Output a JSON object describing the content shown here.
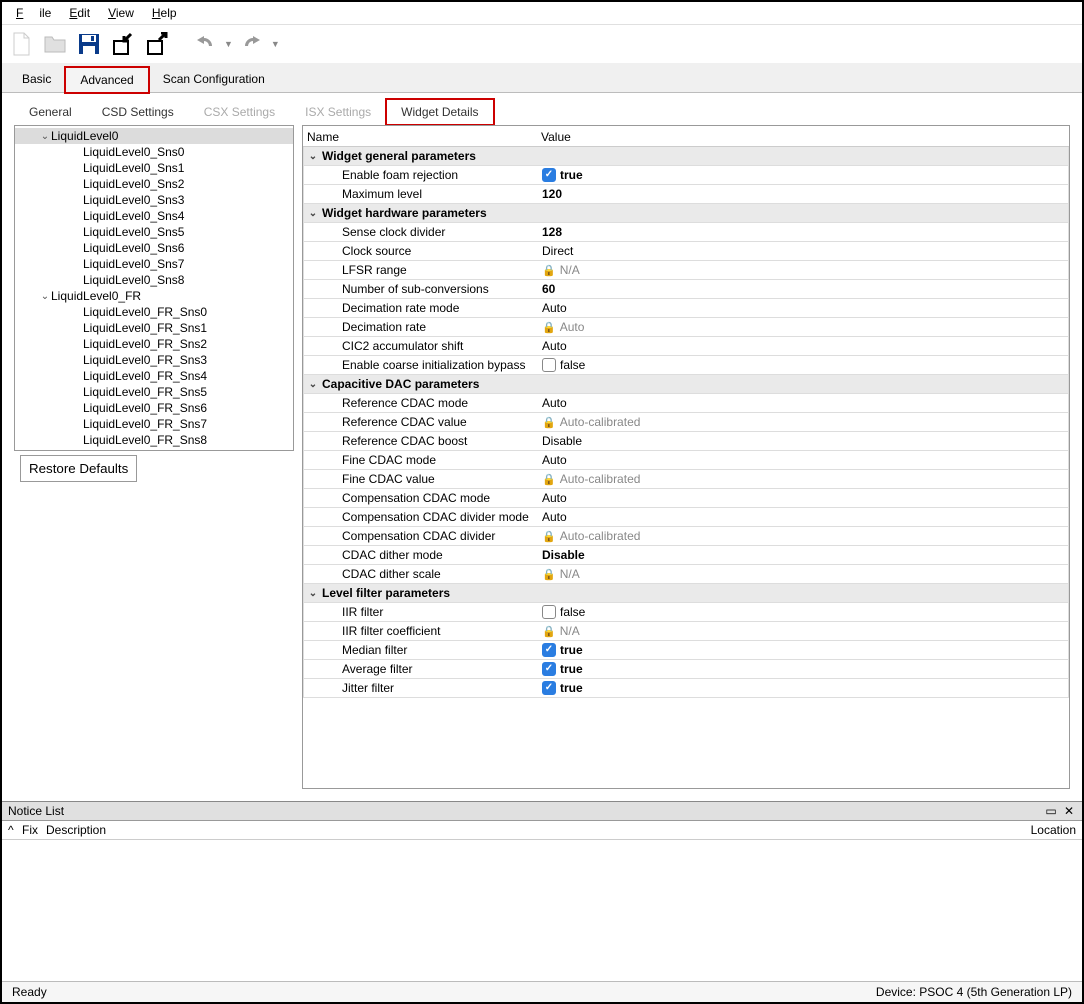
{
  "menu": {
    "file": "File",
    "edit": "Edit",
    "view": "View",
    "help": "Help"
  },
  "main_tabs": {
    "basic": "Basic",
    "advanced": "Advanced",
    "scan": "Scan Configuration",
    "active": "Advanced"
  },
  "sub_tabs": {
    "general": "General",
    "csd": "CSD Settings",
    "csx": "CSX Settings",
    "isx": "ISX Settings",
    "widget": "Widget Details",
    "active": "Widget Details"
  },
  "tree": [
    {
      "label": "LiquidLevel0",
      "depth": 1,
      "expand": true,
      "selected": true
    },
    {
      "label": "LiquidLevel0_Sns0",
      "depth": 2
    },
    {
      "label": "LiquidLevel0_Sns1",
      "depth": 2
    },
    {
      "label": "LiquidLevel0_Sns2",
      "depth": 2
    },
    {
      "label": "LiquidLevel0_Sns3",
      "depth": 2
    },
    {
      "label": "LiquidLevel0_Sns4",
      "depth": 2
    },
    {
      "label": "LiquidLevel0_Sns5",
      "depth": 2
    },
    {
      "label": "LiquidLevel0_Sns6",
      "depth": 2
    },
    {
      "label": "LiquidLevel0_Sns7",
      "depth": 2
    },
    {
      "label": "LiquidLevel0_Sns8",
      "depth": 2
    },
    {
      "label": "LiquidLevel0_FR",
      "depth": 1,
      "expand": true
    },
    {
      "label": "LiquidLevel0_FR_Sns0",
      "depth": 2
    },
    {
      "label": "LiquidLevel0_FR_Sns1",
      "depth": 2
    },
    {
      "label": "LiquidLevel0_FR_Sns2",
      "depth": 2
    },
    {
      "label": "LiquidLevel0_FR_Sns3",
      "depth": 2
    },
    {
      "label": "LiquidLevel0_FR_Sns4",
      "depth": 2
    },
    {
      "label": "LiquidLevel0_FR_Sns5",
      "depth": 2
    },
    {
      "label": "LiquidLevel0_FR_Sns6",
      "depth": 2
    },
    {
      "label": "LiquidLevel0_FR_Sns7",
      "depth": 2
    },
    {
      "label": "LiquidLevel0_FR_Sns8",
      "depth": 2
    }
  ],
  "restore": "Restore Defaults",
  "prop_header": {
    "name": "Name",
    "value": "Value"
  },
  "props": [
    {
      "group": true,
      "name": "Widget general parameters"
    },
    {
      "name": "Enable foam rejection",
      "value": "true",
      "checkbox": true,
      "checked": true,
      "bold": true
    },
    {
      "name": "Maximum level",
      "value": "120",
      "bold": true
    },
    {
      "group": true,
      "name": "Widget hardware parameters"
    },
    {
      "name": "Sense clock divider",
      "value": "128",
      "bold": true
    },
    {
      "name": "Clock source",
      "value": "Direct"
    },
    {
      "name": "LFSR range",
      "value": "N/A",
      "locked": true
    },
    {
      "name": "Number of sub-conversions",
      "value": "60",
      "bold": true
    },
    {
      "name": "Decimation rate mode",
      "value": "Auto"
    },
    {
      "name": "Decimation rate",
      "value": "Auto",
      "locked": true
    },
    {
      "name": "CIC2 accumulator shift",
      "value": "Auto"
    },
    {
      "name": "Enable coarse initialization bypass",
      "value": "false",
      "checkbox": true,
      "checked": false
    },
    {
      "group": true,
      "name": "Capacitive DAC parameters"
    },
    {
      "name": "Reference CDAC mode",
      "value": "Auto"
    },
    {
      "name": "Reference CDAC value",
      "value": "Auto-calibrated",
      "locked": true
    },
    {
      "name": "Reference CDAC boost",
      "value": "Disable"
    },
    {
      "name": "Fine CDAC mode",
      "value": "Auto"
    },
    {
      "name": "Fine CDAC value",
      "value": "Auto-calibrated",
      "locked": true
    },
    {
      "name": "Compensation CDAC mode",
      "value": "Auto"
    },
    {
      "name": "Compensation CDAC divider mode",
      "value": "Auto"
    },
    {
      "name": "Compensation CDAC divider",
      "value": "Auto-calibrated",
      "locked": true
    },
    {
      "name": "CDAC dither mode",
      "value": "Disable",
      "bold": true
    },
    {
      "name": "CDAC dither scale",
      "value": "N/A",
      "locked": true
    },
    {
      "group": true,
      "name": "Level filter parameters"
    },
    {
      "name": "IIR filter",
      "value": "false",
      "checkbox": true,
      "checked": false
    },
    {
      "name": "IIR filter coefficient",
      "value": "N/A",
      "locked": true
    },
    {
      "name": "Median filter",
      "value": "true",
      "checkbox": true,
      "checked": true,
      "bold": true
    },
    {
      "name": "Average filter",
      "value": "true",
      "checkbox": true,
      "checked": true,
      "bold": true
    },
    {
      "name": "Jitter filter",
      "value": "true",
      "checkbox": true,
      "checked": true,
      "bold": true
    }
  ],
  "notice": {
    "title": "Notice List",
    "fix": "Fix",
    "description": "Description",
    "location": "Location"
  },
  "status": {
    "ready": "Ready",
    "device": "Device: PSOC 4 (5th Generation LP)"
  }
}
